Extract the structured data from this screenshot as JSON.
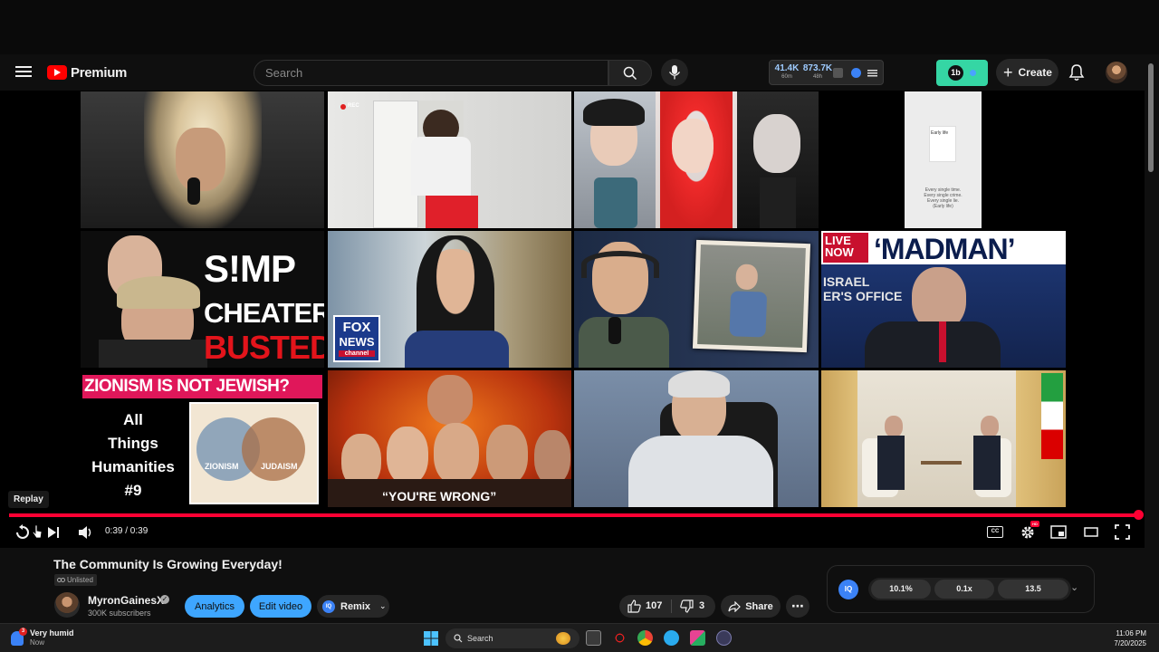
{
  "masthead": {
    "logo_text": "Premium",
    "search_placeholder": "Search",
    "ext_stats": [
      {
        "num": "41.4K",
        "sub": "60m"
      },
      {
        "num": "873.7K",
        "sub": "48h"
      }
    ],
    "ext_badge_text": "1b",
    "create_label": "Create"
  },
  "thumbnails": {
    "simp_line1": "S!MP",
    "simp_line2": "CHEATER",
    "simp_line3": "BUSTED",
    "fox_line1": "FOX",
    "fox_line2": "NEWS",
    "fox_line3": "channel",
    "live_now": "LIVE NOW",
    "fox_small": "FOX",
    "madman": "‘MADMAN’",
    "israel_line1": "ISRAEL",
    "israel_line2": "ER'S OFFICE",
    "zion_banner": "ZIONISM IS NOT JEWISH?",
    "humanities": [
      "All",
      "Things",
      "Humanities",
      "#9"
    ],
    "venn_left": "ZIONISM",
    "venn_right": "JUDAISM",
    "youre_wrong": "“YOU'RE WRONG”",
    "rec": "REC",
    "doc_heading": "Early life",
    "doc_lines": [
      "Every single time.",
      "Every single crime.",
      "Every single lie.",
      "(Early life)"
    ]
  },
  "player": {
    "replay_tooltip": "Replay",
    "time": "0:39 / 0:39",
    "cc_label": "CC",
    "settings_badge": "HD",
    "progress_fraction": 1.0
  },
  "video": {
    "title": "The Community Is Growing Everyday!",
    "visibility": "Unlisted",
    "channel": "MyronGainesX",
    "subscribers": "300K subscribers",
    "analytics_label": "Analytics",
    "edit_label": "Edit video",
    "remix_label": "Remix",
    "iq_badge": "IQ",
    "likes": "107",
    "dislikes": "3",
    "share_label": "Share"
  },
  "ext_panel": {
    "iq_badge": "IQ",
    "chips": [
      "10.1%",
      "0.1x",
      "13.5"
    ]
  },
  "taskbar": {
    "weather_title": "Very humid",
    "weather_sub": "Now",
    "weather_badge": "3",
    "search_label": "Search",
    "time": "11:06 PM",
    "date": "7/20/2025"
  },
  "colors": {
    "accent_red": "#ff0033",
    "brand_red": "#ff0000",
    "link_blue": "#3ea6ff",
    "ext_green": "#35d6a4"
  }
}
